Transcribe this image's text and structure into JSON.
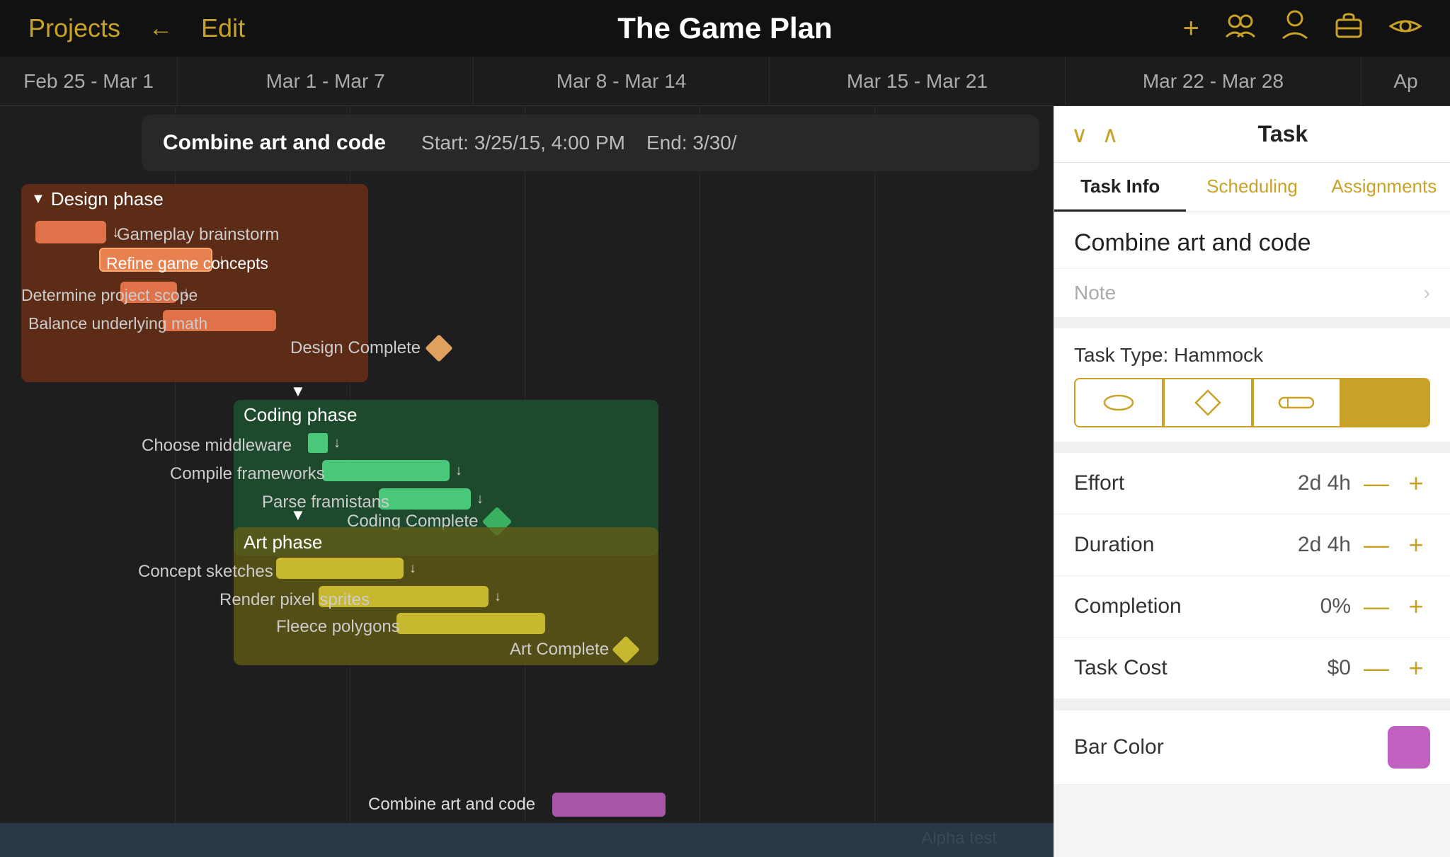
{
  "app": {
    "title": "The Game Plan",
    "nav": {
      "projects_label": "Projects",
      "edit_label": "Edit",
      "back_icon": "←"
    },
    "icons": {
      "add": "+",
      "group": "👥",
      "person": "👤",
      "briefcase": "💼",
      "eye": "👁"
    }
  },
  "timeline": {
    "columns": [
      "Feb 25 - Mar 1",
      "Mar 1 - Mar 7",
      "Mar 8 - Mar 14",
      "Mar 15 - Mar 21",
      "Mar 22 - Mar 28",
      "Ap"
    ]
  },
  "tooltip": {
    "text": "Combine art and code",
    "start": "Start: 3/25/15, 4:00 PM",
    "end": "End: 3/30/"
  },
  "gantt": {
    "phases": [
      {
        "id": "design",
        "label": "Design phase",
        "tasks": [
          {
            "name": "Gameplay brainstorm",
            "type": "bar",
            "color": "#e0724a"
          },
          {
            "name": "Refine game concepts",
            "type": "bar",
            "color": "#e0724a",
            "highlighted": true
          },
          {
            "name": "Determine project scope",
            "type": "bar",
            "color": "#e0724a"
          },
          {
            "name": "Balance underlying math",
            "type": "bar",
            "color": "#e0724a"
          }
        ],
        "milestone": "Design Complete"
      },
      {
        "id": "coding",
        "label": "Coding phase",
        "tasks": [
          {
            "name": "Choose middleware",
            "type": "bar",
            "color": "#4ac87a"
          },
          {
            "name": "Compile frameworks",
            "type": "bar",
            "color": "#4ac87a"
          },
          {
            "name": "Parse framistans",
            "type": "bar",
            "color": "#4ac87a"
          }
        ],
        "milestone": "Coding Complete"
      },
      {
        "id": "art",
        "label": "Art phase",
        "tasks": [
          {
            "name": "Concept sketches",
            "type": "bar",
            "color": "#c8b830"
          },
          {
            "name": "Render pixel sprites",
            "type": "bar",
            "color": "#c8b830"
          },
          {
            "name": "Fleece polygons",
            "type": "bar",
            "color": "#c8b830"
          }
        ],
        "milestone": "Art Complete"
      }
    ],
    "combine_task": {
      "name": "Combine art and code",
      "color": "#c060c0"
    },
    "alpha_task": {
      "name": "Alpha test"
    }
  },
  "panel": {
    "nav": {
      "title": "Task",
      "prev_icon": "∨",
      "next_icon": "∧"
    },
    "tabs": [
      {
        "label": "Task Info",
        "active": true
      },
      {
        "label": "Scheduling",
        "active": false
      },
      {
        "label": "Assignments",
        "active": false
      }
    ],
    "task_name": "Combine art and code",
    "note_label": "Note",
    "task_type_label": "Task Type: Hammock",
    "task_types": [
      {
        "icon": "⬭",
        "label": "normal"
      },
      {
        "icon": "◇",
        "label": "milestone"
      },
      {
        "icon": "⊟",
        "label": "hammered"
      },
      {
        "icon": "⬭",
        "label": "hammock",
        "active": true
      }
    ],
    "fields": [
      {
        "label": "Effort",
        "value": "2d 4h"
      },
      {
        "label": "Duration",
        "value": "2d 4h"
      },
      {
        "label": "Completion",
        "value": "0%"
      },
      {
        "label": "Task Cost",
        "value": "$0"
      }
    ],
    "bar_color_label": "Bar Color",
    "bar_color": "#c060c0"
  }
}
